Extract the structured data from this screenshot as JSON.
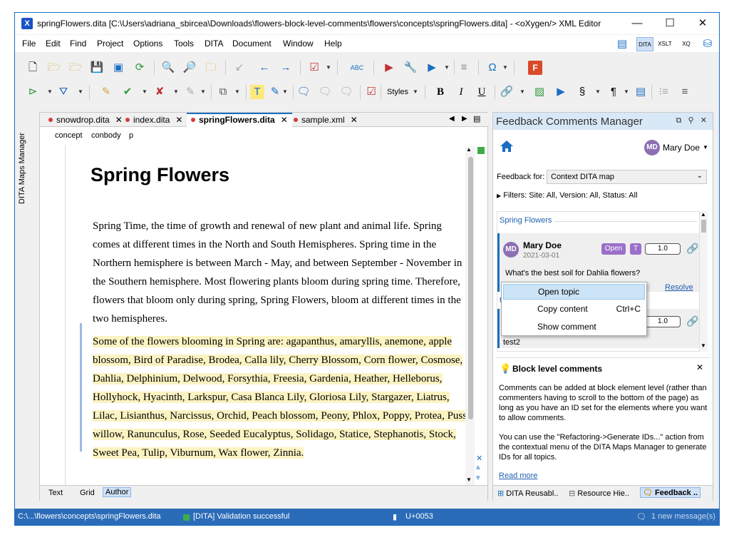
{
  "window": {
    "title": "springFlowers.dita [C:\\Users\\adriana_sbircea\\Downloads\\flowers-block-level-comments\\flowers\\concepts\\springFlowers.dita] - <oXygen/> XML Editor",
    "minimize": "—",
    "maximize": "☐",
    "close": "✕"
  },
  "menu": [
    "File",
    "Edit",
    "Find",
    "Project",
    "Options",
    "Tools",
    "DITA",
    "Document",
    "Window",
    "Help"
  ],
  "toolbar": {
    "styles_label": "Styles"
  },
  "side_panel": {
    "label": "DITA Maps Manager"
  },
  "editor": {
    "tabs": [
      {
        "label": "snowdrop.dita",
        "active": false
      },
      {
        "label": "index.dita",
        "active": false
      },
      {
        "label": "springFlowers.dita",
        "active": true
      },
      {
        "label": "sample.xml",
        "active": false
      }
    ],
    "breadcrumb": [
      "concept",
      "conbody",
      "p"
    ],
    "title": "Spring Flowers",
    "para1": "Spring Time, the time of growth and renewal of new plant and animal life. Spring comes at different times in the North and South Hemispheres. Spring time in the Northern hemisphere is between March - May, and between September - November in the Southern hemisphere. Most flowering plants bloom during spring time. Therefore, flowers that bloom only during spring, Spring Flowers, bloom at different times in the two hemispheres.",
    "para2": "Some of the flowers blooming in Spring are: agapanthus, amaryllis, anemone, apple blossom, Bird of Paradise, Brodea, Calla lily, Cherry Blossom, Corn flower, Cosmose, Dahlia, Delphinium, Delwood, Forsythia, Freesia, Gardenia, Heather, Helleborus, Hollyhock, Hyacinth, Larkspur, Casa Blanca Lily, Gloriosa Lily, Stargazer, Liatrus, Lilac, Lisianthus, Narcissus, Orchid, Peach blossom, Peony, Phlox, Poppy, Protea, Pussy willow, Ranunculus, Rose, Seeded Eucalyptus, Solidago, Statice, Stephanotis, Stock, Sweet Pea, Tulip, Viburnum, Wax flower, Zinnia.",
    "modes": [
      "Text",
      "Grid",
      "Author"
    ],
    "active_mode": "Author"
  },
  "feedback": {
    "title": "Feedback Comments Manager",
    "user_initials": "MD",
    "user_name": "Mary Doe",
    "feedback_for_label": "Feedback for:",
    "feedback_for_value": "Context DITA map",
    "filters": "Filters:  Site: All, Version: All, Status: All",
    "thread_title": "Spring Flowers",
    "comment": {
      "initials": "MD",
      "author": "Mary Doe",
      "date": "2021-03-01",
      "status": "Open",
      "tag": "T",
      "version": "1.0",
      "text": "What's the best soil for Dahlia flowers?",
      "resolve": "Resolve"
    },
    "second": {
      "topic_prefix": "topic",
      "initials": "A",
      "version": "1.0",
      "text": "test2"
    },
    "context_menu": [
      {
        "label": "Open topic",
        "shortcut": ""
      },
      {
        "label": "Copy content",
        "shortcut": "Ctrl+C"
      },
      {
        "label": "Show comment",
        "shortcut": ""
      }
    ],
    "block": {
      "title": "Block level comments",
      "p1": "Comments can be added at block element level (rather than commenters having to scroll to the bottom of the page) as long as you have an ID set for the elements where you want to allow comments.",
      "p2": "You can use the \"Refactoring->Generate IDs...\" action from the contextual menu of the DITA Maps Manager to generate IDs for all topics.",
      "link": "Read more"
    },
    "bottom_tabs": [
      "DITA Reusabl..",
      "Resource Hie..",
      "Feedback .."
    ]
  },
  "status": {
    "path": "C:\\...\\flowers\\concepts\\springFlowers.dita",
    "validation": "[DITA] Validation successful",
    "unicode": "U+0053",
    "messages": "1 new message(s)"
  },
  "colors": {
    "accent": "#1b6ec2",
    "highlight": "#fcf3c3",
    "status_bar": "#2b6cb8"
  }
}
